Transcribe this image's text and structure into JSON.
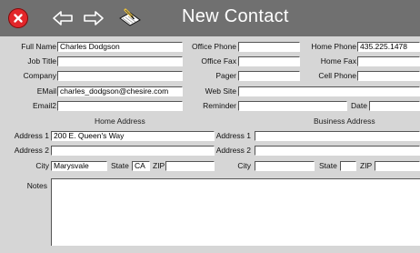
{
  "window": {
    "title": "New Contact"
  },
  "toolbar": {
    "close_icon": "close-icon",
    "back_icon": "back-arrow-icon",
    "forward_icon": "forward-arrow-icon",
    "notes_icon": "notepad-pen-icon",
    "close_color": "#e3262a"
  },
  "contact": {
    "full_name_label": "Full Name",
    "full_name": "Charles Dodgson",
    "job_title_label": "Job Title",
    "job_title": "",
    "company_label": "Company",
    "company": "",
    "email_label": "EMail",
    "email": "charles_dodgson@chesire.com",
    "email2_label": "Email2",
    "email2": "",
    "office_phone_label": "Office Phone",
    "office_phone": "",
    "office_fax_label": "Office Fax",
    "office_fax": "",
    "pager_label": "Pager",
    "pager": "",
    "web_site_label": "Web Site",
    "web_site": "",
    "reminder_label": "Reminder",
    "reminder": "",
    "date_label": "Date",
    "date": "",
    "home_phone_label": "Home Phone",
    "home_phone": "435.225.1478",
    "home_fax_label": "Home Fax",
    "home_fax": "",
    "cell_phone_label": "Cell Phone",
    "cell_phone": ""
  },
  "home_address": {
    "heading": "Home Address",
    "address1_label": "Address 1",
    "address1": "200 E. Queen's Way",
    "address2_label": "Address 2",
    "address2": "",
    "city_label": "City",
    "city": "Marysvale",
    "state_label": "State",
    "state": "CA",
    "zip_label": "ZIP",
    "zip": ""
  },
  "business_address": {
    "heading": "Business Address",
    "address1_label": "Address 1",
    "address1": "",
    "address2_label": "Address 2",
    "address2": "",
    "city_label": "City",
    "city": "",
    "state_label": "State",
    "state": "",
    "zip_label": "ZIP",
    "zip": ""
  },
  "notes": {
    "label": "Notes",
    "value": ""
  }
}
